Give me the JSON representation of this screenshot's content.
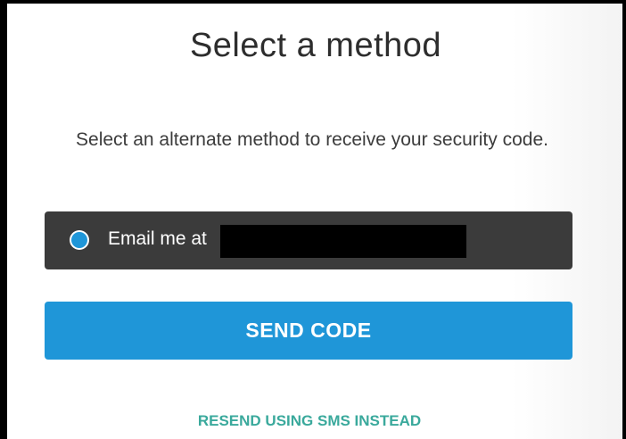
{
  "heading": "Select a method",
  "description": "Select an alternate method to receive your security code.",
  "method_option": {
    "label": "Email me at",
    "selected": true
  },
  "send_button_label": "SEND CODE",
  "resend_link_label": "RESEND USING SMS INSTEAD",
  "colors": {
    "accent_blue": "#1f96d8",
    "option_background": "#3b3b3b",
    "link_teal": "#3aa99c"
  }
}
